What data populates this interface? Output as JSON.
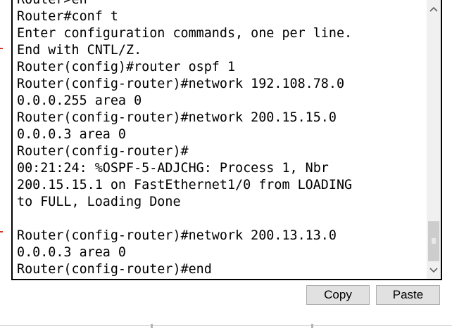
{
  "terminal": {
    "lines": [
      "Router>en",
      "Router#conf t",
      "Enter configuration commands, one per line.",
      "End with CNTL/Z.",
      "Router(config)#router ospf 1",
      "Router(config-router)#network 192.108.78.0",
      "0.0.0.255 area 0",
      "Router(config-router)#network 200.15.15.0",
      "0.0.0.3 area 0",
      "Router(config-router)#",
      "00:21:24: %OSPF-5-ADJCHG: Process 1, Nbr",
      "200.15.15.1 on FastEthernet1/0 from LOADING",
      "to FULL, Loading Done",
      "",
      "Router(config-router)#network 200.13.13.0",
      "0.0.0.3 area 0",
      "Router(config-router)#end"
    ]
  },
  "scrollbar": {
    "up_icon": "chevron-up-icon",
    "down_icon": "chevron-down-icon",
    "position": 0.95
  },
  "buttons": {
    "copy_label": "Copy",
    "paste_label": "Paste"
  },
  "colors": {
    "terminal_text": "#000000",
    "terminal_background": "#ffffff",
    "button_background": "#e1e1e1",
    "button_border": "#adadad",
    "scrollbar_track": "#f0f0f0",
    "scrollbar_thumb": "#cdcdcd"
  }
}
